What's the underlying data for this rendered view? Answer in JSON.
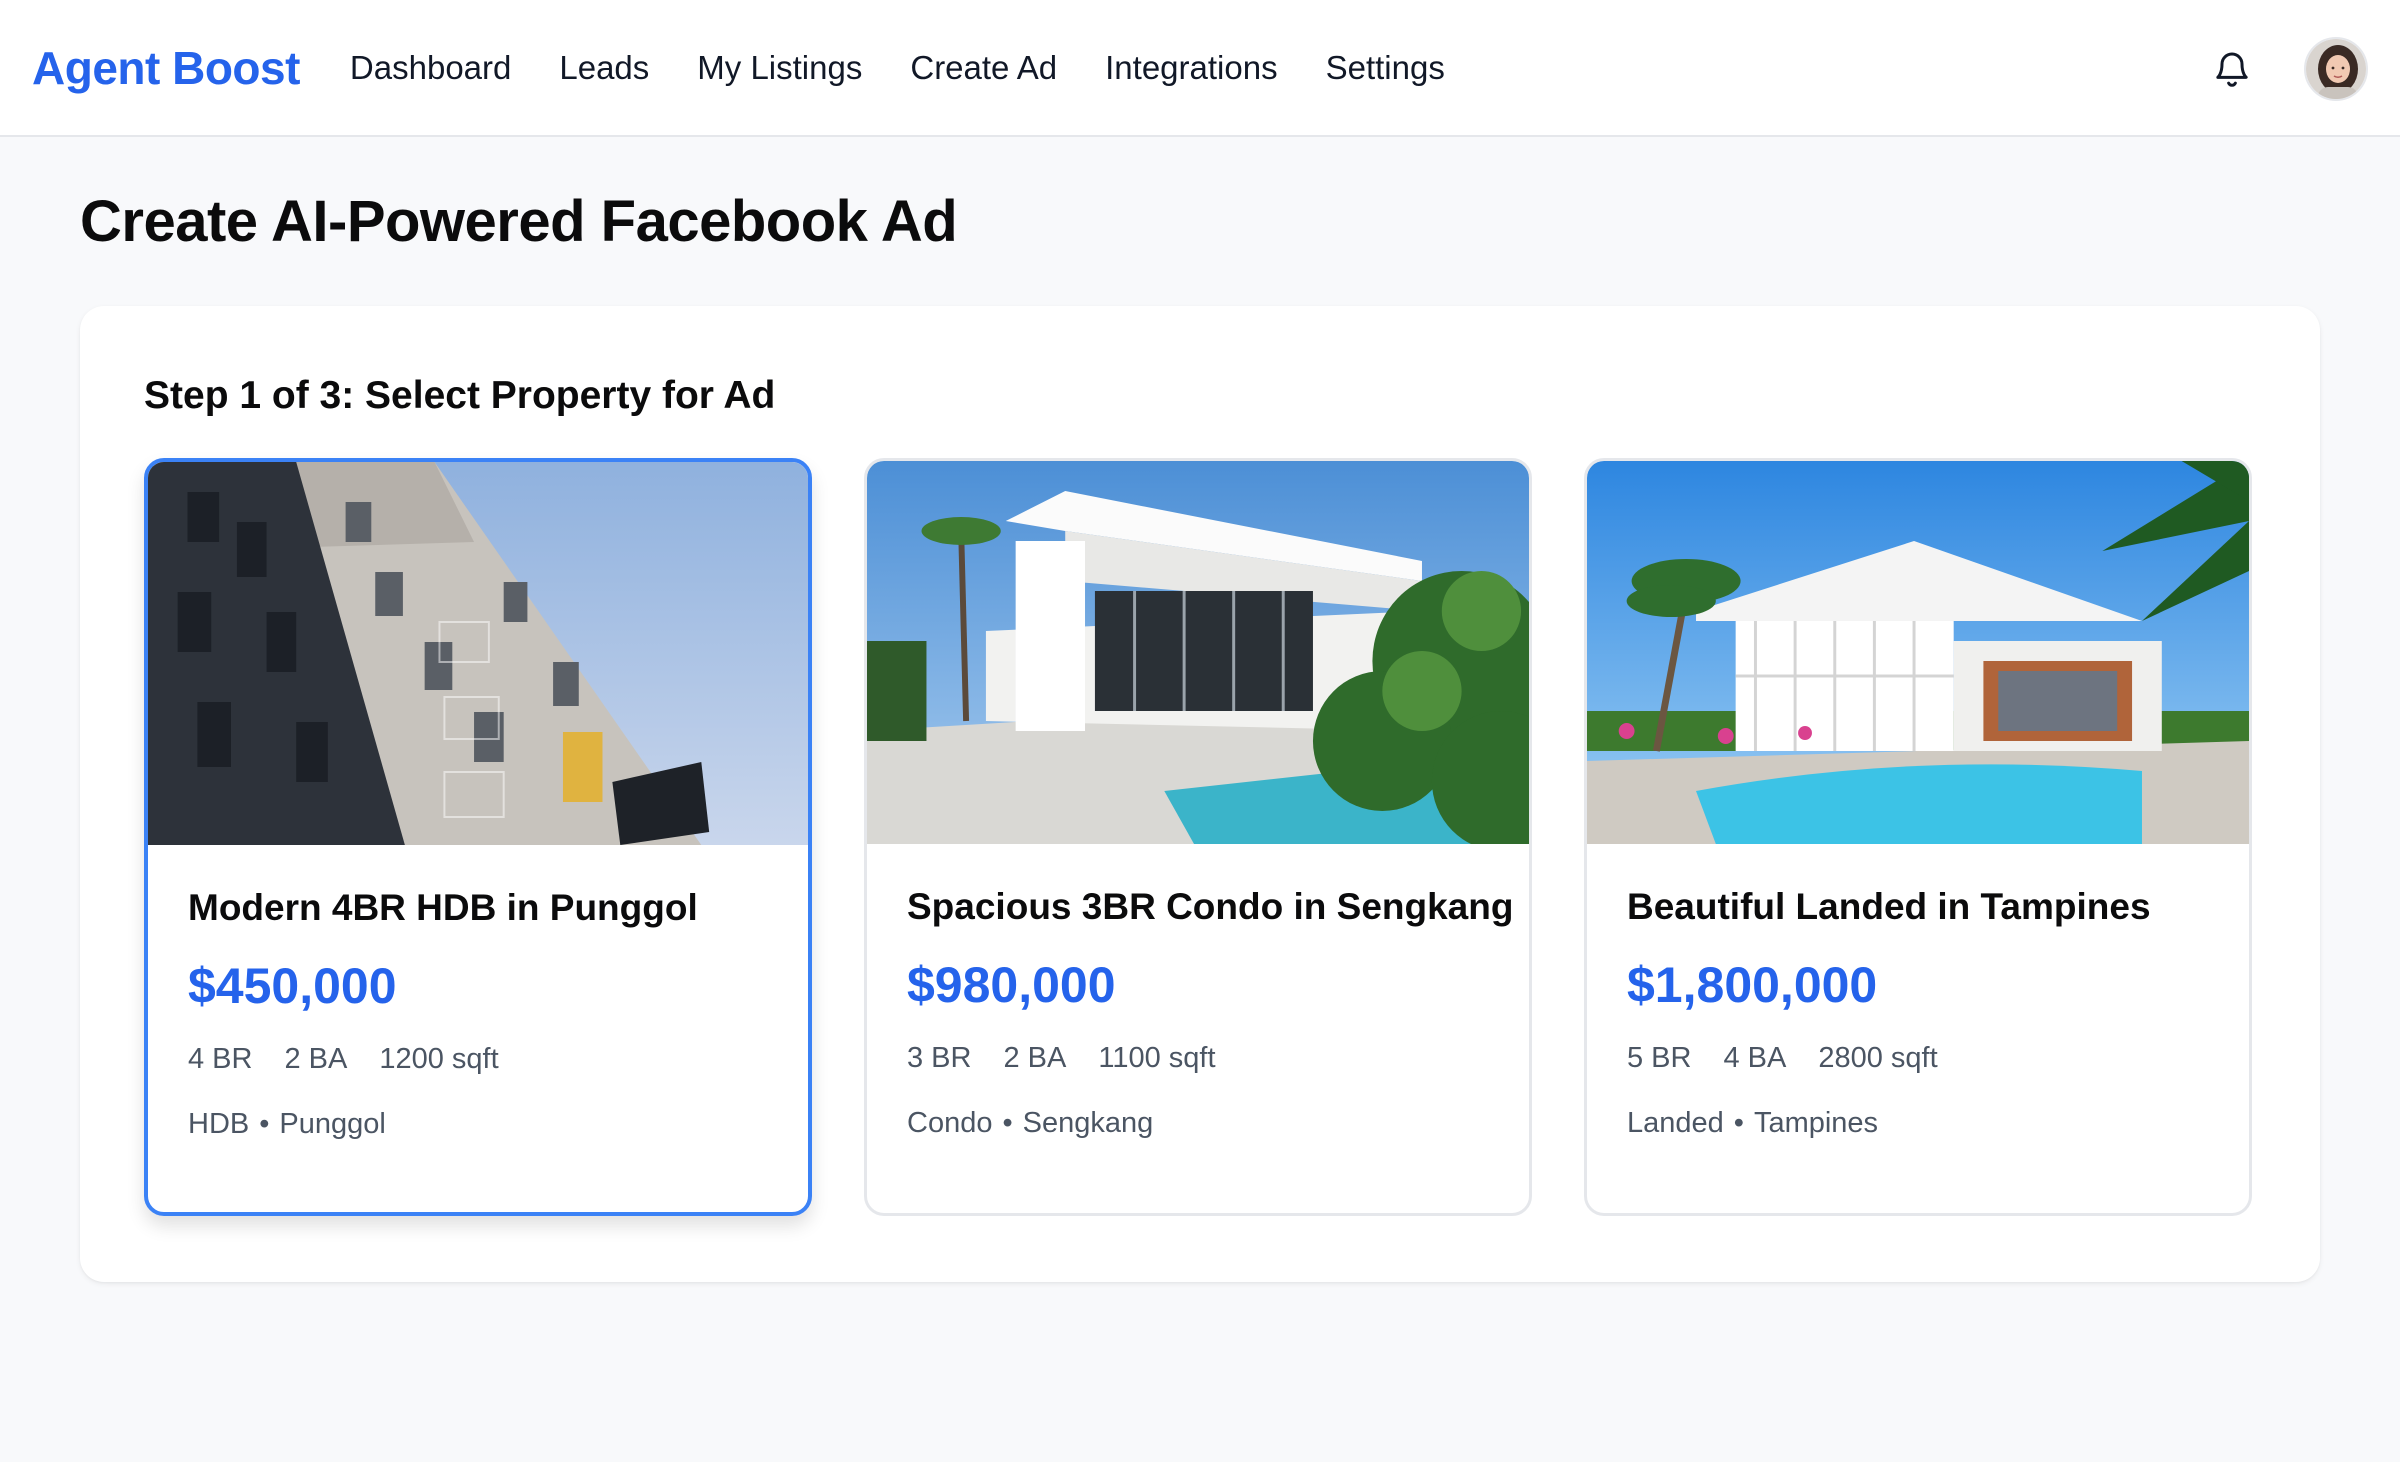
{
  "app": {
    "brand": "Agent Boost"
  },
  "nav": {
    "items": [
      "Dashboard",
      "Leads",
      "My Listings",
      "Create Ad",
      "Integrations",
      "Settings"
    ]
  },
  "header_icons": {
    "notifications": "bell-icon",
    "profile": "avatar"
  },
  "page": {
    "title": "Create AI-Powered Facebook Ad",
    "step_title": "Step 1 of 3: Select Property for Ad"
  },
  "properties": [
    {
      "title": "Modern 4BR HDB in Punggol",
      "price": "$450,000",
      "beds": "4 BR",
      "baths": "2 BA",
      "area": "1200 sqft",
      "type": "HDB",
      "location": "Punggol",
      "selected": true
    },
    {
      "title": "Spacious 3BR Condo in Sengkang",
      "price": "$980,000",
      "beds": "3 BR",
      "baths": "2 BA",
      "area": "1100 sqft",
      "type": "Condo",
      "location": "Sengkang",
      "selected": false
    },
    {
      "title": "Beautiful Landed in Tampines",
      "price": "$1,800,000",
      "beds": "5 BR",
      "baths": "4 BA",
      "area": "2800 sqft",
      "type": "Landed",
      "location": "Tampines",
      "selected": false
    }
  ],
  "colors": {
    "brand": "#2563eb",
    "selected_border": "#3b82f6",
    "page_bg": "#f8f9fb"
  }
}
